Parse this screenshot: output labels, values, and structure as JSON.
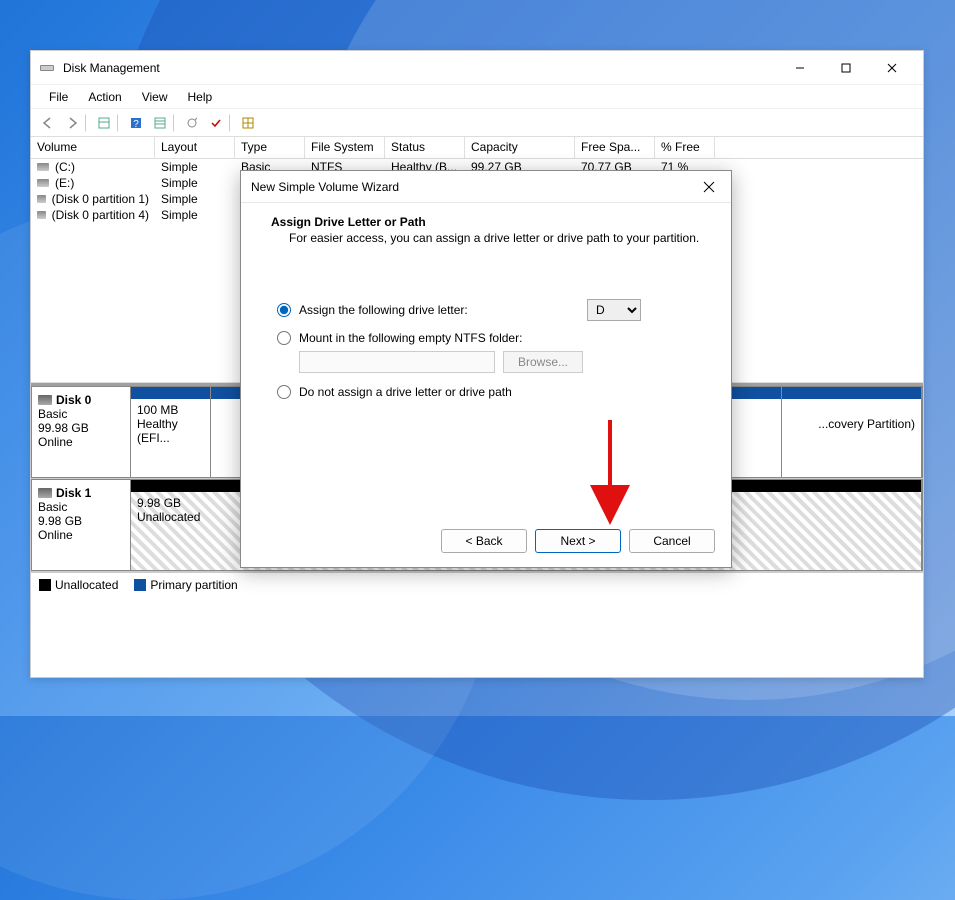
{
  "window": {
    "title": "Disk Management"
  },
  "menu": {
    "file": "File",
    "action": "Action",
    "view": "View",
    "help": "Help"
  },
  "table": {
    "headers": {
      "volume": "Volume",
      "layout": "Layout",
      "type": "Type",
      "fs": "File System",
      "status": "Status",
      "capacity": "Capacity",
      "free": "Free Spa...",
      "pct": "% Free"
    },
    "rows": [
      {
        "volume": "(C:)",
        "layout": "Simple",
        "type": "Basic",
        "fs": "NTFS",
        "status": "Healthy (B...",
        "capacity": "99.27 GB",
        "free": "70.77 GB",
        "pct": "71 %"
      },
      {
        "volume": "(E:)",
        "layout": "Simple",
        "type": "",
        "fs": "",
        "status": "",
        "capacity": "",
        "free": "",
        "pct": ""
      },
      {
        "volume": "(Disk 0 partition 1)",
        "layout": "Simple",
        "type": "",
        "fs": "",
        "status": "",
        "capacity": "",
        "free": "",
        "pct": ""
      },
      {
        "volume": "(Disk 0 partition 4)",
        "layout": "Simple",
        "type": "",
        "fs": "",
        "status": "",
        "capacity": "",
        "free": "",
        "pct": ""
      }
    ]
  },
  "disks": {
    "d0": {
      "name": "Disk 0",
      "type": "Basic",
      "size": "99.98 GB",
      "status": "Online",
      "p1_size": "100 MB",
      "p1_status": "Healthy (EFI...",
      "p4_label": "...covery Partition)"
    },
    "d1": {
      "name": "Disk 1",
      "type": "Basic",
      "size": "9.98 GB",
      "status": "Online",
      "p1_size": "9.98 GB",
      "p1_status": "Unallocated"
    }
  },
  "legend": {
    "unallocated": "Unallocated",
    "primary": "Primary partition"
  },
  "dialog": {
    "title": "New Simple Volume Wizard",
    "header_title": "Assign Drive Letter or Path",
    "header_sub": "For easier access, you can assign a drive letter or drive path to your partition.",
    "opt_assign": "Assign the following drive letter:",
    "opt_mount": "Mount in the following empty NTFS folder:",
    "opt_none": "Do not assign a drive letter or drive path",
    "browse": "Browse...",
    "selected_letter": "D",
    "back": "< Back",
    "next": "Next >",
    "cancel": "Cancel"
  }
}
